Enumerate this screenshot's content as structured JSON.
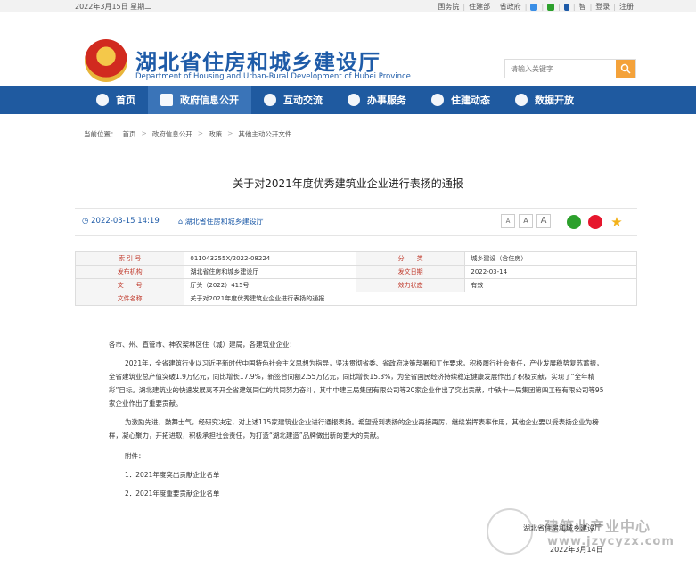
{
  "topbar": {
    "date": "2022年3月15日 星期二",
    "links": [
      "国务院",
      "住建部",
      "省政府",
      "智",
      "登录",
      "注册"
    ]
  },
  "header": {
    "title_cn": "湖北省住房和城乡建设厅",
    "title_en": "Department of Housing and Urban-Rural Development of Hubei Province",
    "search_placeholder": "请输入关键字"
  },
  "nav": [
    {
      "label": "首页"
    },
    {
      "label": "政府信息公开"
    },
    {
      "label": "互动交流"
    },
    {
      "label": "办事服务"
    },
    {
      "label": "住建动态"
    },
    {
      "label": "数据开放"
    }
  ],
  "breadcrumb": {
    "prefix": "当前位置：",
    "items": [
      "首页",
      "政府信息公开",
      "政策",
      "其他主动公开文件"
    ]
  },
  "article": {
    "title": "关于对2021年度优秀建筑业企业进行表扬的通报",
    "time": "2022-03-15 14:19",
    "publisher": "湖北省住房和城乡建设厅",
    "font_sizes": [
      "A",
      "A",
      "A"
    ]
  },
  "info_table": [
    {
      "k1": "索 引 号",
      "v1": "011043255X/2022-08224",
      "k2": "分　　类",
      "v2": "城乡建设（含住房）"
    },
    {
      "k1": "发布机构",
      "v1": "湖北省住房和城乡建设厅",
      "k2": "发文日期",
      "v2": "2022-03-14"
    },
    {
      "k1": "文　　号",
      "v1": "厅头（2022）415号",
      "k2": "效力状态",
      "v2": "有效"
    },
    {
      "k1": "文件名称",
      "v1": "关于对2021年度优秀建筑业企业进行表扬的通报",
      "k2": "",
      "v2": ""
    }
  ],
  "body": {
    "salutation": "各市、州、直管市、神农架林区住（城）建局，各建筑业企业：",
    "p1": "2021年，全省建筑行业以习近平新时代中国特色社会主义思想为指导，坚决贯彻省委、省政府决策部署和工作要求，积极履行社会责任，产业发展稳势复苏蓄振，全省建筑业总产值突破1.9万亿元，同比增长17.9%，新签合同额2.55万亿元，同比增长15.3%，为全省国民经济持续稳定健康发展作出了积极贡献，实现了“全年精彩”目标。湖北建筑业的快速发展离不开全省建筑同仁的共同努力奋斗，其中中建三局集团有限公司等20家企业作出了突出贡献，中铁十一局集团第四工程有限公司等95家企业作出了重要贡献。",
    "p2": "为激励先进，鼓舞士气，经研究决定，对上述115家建筑业企业进行通报表扬。希望受到表扬的企业再接再厉，继续发挥表率作用，其他企业要以受表扬企业为榜样，凝心聚力，开拓进取，积极承担社会责任，为打造“湖北建造”品牌做出新的更大的贡献。",
    "attach_label": "附件：",
    "attachments": [
      "1．2021年度突出贡献企业名单",
      "2．2021年度重要贡献企业名单"
    ],
    "sign": "湖北省住房和城乡建设厅",
    "sign_date": "2022年3月14日"
  },
  "watermark": {
    "title": "建筑业产业中心",
    "url": "www.jzycyzx.com"
  }
}
